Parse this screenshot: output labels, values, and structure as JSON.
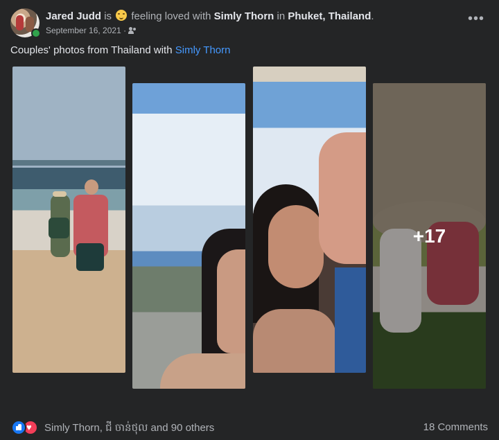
{
  "post": {
    "author": "Jared Judd",
    "connector_is": "is",
    "feeling": "feeling loved with",
    "tagged": "Simly Thorn",
    "connector_in": "in",
    "location": "Phuket, Thailand",
    "period": ".",
    "date": "September 16, 2021",
    "separator": "·",
    "audience_icon": "friends-icon",
    "feeling_icon": "smiling-face-icon",
    "more_icon": "more-options-icon",
    "more_label": "•••"
  },
  "caption": {
    "text": "Couples' photos from Thailand with",
    "tag": "Simly Thorn"
  },
  "photos": {
    "more_count": "+17"
  },
  "footer": {
    "reactions_text": "Simly Thorn, ជី ចាន់ថុល and 90 others",
    "comments": "18 Comments",
    "like_icon": "like-reaction-icon",
    "love_icon": "love-reaction-icon",
    "like_color": "#1877f2",
    "love_color": "#f33e58"
  },
  "colors": {
    "background": "#242526",
    "link": "#4599ff",
    "primary_text": "#e4e6eb",
    "secondary_text": "#b0b3b8"
  }
}
